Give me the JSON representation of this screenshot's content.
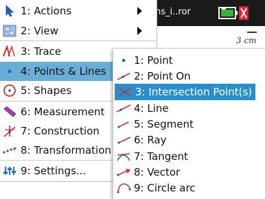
{
  "document": {
    "title": "flections_i..ror",
    "ruler_label": "3 cm"
  },
  "main_menu": {
    "items": [
      {
        "label": "1: Actions",
        "icon": "arrow-cursor-icon"
      },
      {
        "label": "2: View",
        "icon": "view-icon"
      },
      {
        "label": "3: Trace",
        "icon": "trace-icon"
      },
      {
        "label": "4: Points & Lines",
        "icon": "point-icon"
      },
      {
        "label": "5: Shapes",
        "icon": "circle-shape-icon"
      },
      {
        "label": "6: Measurement",
        "icon": "ruler-icon"
      },
      {
        "label": "7: Construction",
        "icon": "construction-icon"
      },
      {
        "label": "8: Transformation",
        "icon": "transformation-icon"
      },
      {
        "label": "9: Settings...",
        "icon": "settings-icon"
      }
    ]
  },
  "sub_menu": {
    "items": [
      {
        "label": "1: Point",
        "icon": "point-icon"
      },
      {
        "label": "2: Point On",
        "icon": "point-on-icon"
      },
      {
        "label": "3: Intersection Point(s)",
        "icon": "intersection-point-icon"
      },
      {
        "label": "4: Line",
        "icon": "line-icon"
      },
      {
        "label": "5: Segment",
        "icon": "segment-icon"
      },
      {
        "label": "6: Ray",
        "icon": "ray-icon"
      },
      {
        "label": "7: Tangent",
        "icon": "tangent-icon"
      },
      {
        "label": "8: Vector",
        "icon": "vector-icon"
      },
      {
        "label": "9: Circle arc",
        "icon": "circle-arc-icon"
      }
    ]
  },
  "colors": {
    "main_highlight": "#6aaed6",
    "sub_highlight": "#2a8fc9",
    "title_bar": "#1a1a1a"
  }
}
